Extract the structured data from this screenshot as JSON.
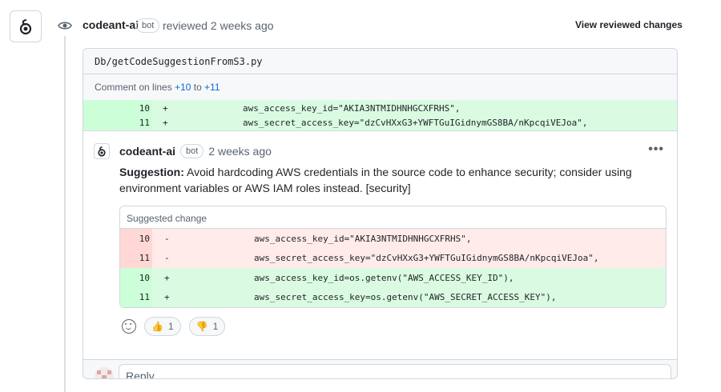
{
  "header": {
    "author": "codeant-ai",
    "badge": "bot",
    "action": "reviewed 2 weeks ago",
    "view_changes": "View reviewed changes"
  },
  "file": {
    "path": "Db/getCodeSuggestionFromS3.py",
    "comment_on_prefix": "Comment on lines",
    "line_from": "+10",
    "line_to_word": "to",
    "line_to": "+11"
  },
  "context_lines": [
    {
      "num": "10",
      "sign": "+",
      "code": "        aws_access_key_id=\"AKIA3NTMIDHNHGCXFRHS\","
    },
    {
      "num": "11",
      "sign": "+",
      "code": "        aws_secret_access_key=\"dzCvHXxG3+YWFTGuIGidnymGS8BA/nKpcqiVEJoa\","
    }
  ],
  "comment": {
    "author": "codeant-ai",
    "badge": "bot",
    "time": "2 weeks ago",
    "more": "•••",
    "suggestion_label": "Suggestion:",
    "body": " Avoid hardcoding AWS credentials in the source code to enhance security; consider using environment variables or AWS IAM roles instead. [security]"
  },
  "suggested_change": {
    "title": "Suggested change",
    "removed": [
      {
        "num": "10",
        "sign": "-",
        "code": "        aws_access_key_id=\"AKIA3NTMIDHNHGCXFRHS\","
      },
      {
        "num": "11",
        "sign": "-",
        "code": "        aws_secret_access_key=\"dzCvHXxG3+YWFTGuIGidnymGS8BA/nKpcqiVEJoa\","
      }
    ],
    "added": [
      {
        "num": "10",
        "sign": "+",
        "code": "        aws_access_key_id=os.getenv(\"AWS_ACCESS_KEY_ID\"),"
      },
      {
        "num": "11",
        "sign": "+",
        "code": "        aws_secret_access_key=os.getenv(\"AWS_SECRET_ACCESS_KEY\"),"
      }
    ]
  },
  "reactions": {
    "thumbs_up_count": "1",
    "thumbs_down_count": "1"
  },
  "reply": {
    "placeholder": "Reply..."
  }
}
